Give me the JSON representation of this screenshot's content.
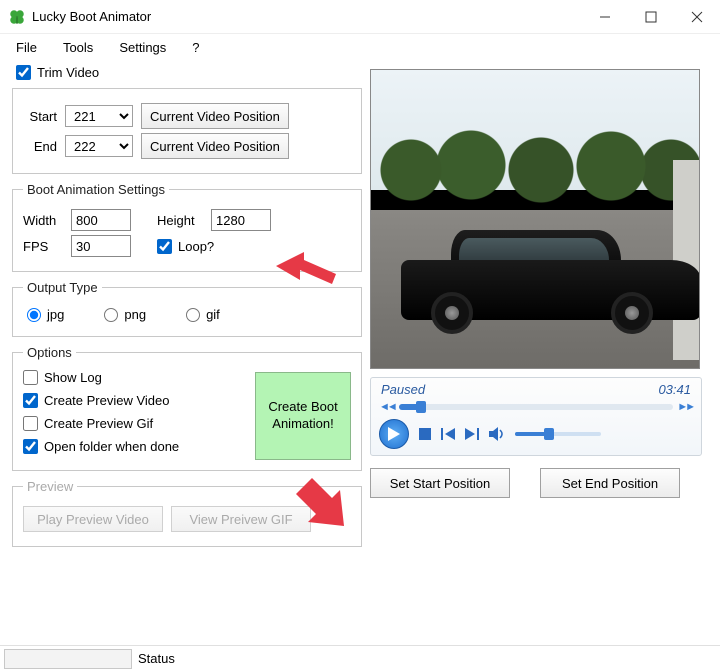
{
  "window": {
    "title": "Lucky Boot Animator"
  },
  "menu": {
    "file": "File",
    "tools": "Tools",
    "settings": "Settings",
    "help": "?"
  },
  "trim": {
    "label": "Trim Video",
    "start_lbl": "Start",
    "start_val": "221",
    "start_btn": "Current Video Position",
    "end_lbl": "End",
    "end_val": "222",
    "end_btn": "Current Video Position"
  },
  "bas": {
    "legend": "Boot Animation Settings",
    "width_lbl": "Width",
    "width_val": "800",
    "height_lbl": "Height",
    "height_val": "1280",
    "fps_lbl": "FPS",
    "fps_val": "30",
    "loop_lbl": "Loop?"
  },
  "output": {
    "legend": "Output Type",
    "jpg": "jpg",
    "png": "png",
    "gif": "gif"
  },
  "options": {
    "legend": "Options",
    "show_log": "Show Log",
    "preview_video": "Create Preview Video",
    "preview_gif": "Create Preview Gif",
    "open_folder": "Open folder when done",
    "create_btn": "Create Boot Animation!"
  },
  "preview": {
    "legend": "Preview",
    "play": "Play Preview Video",
    "view": "View Preivew GIF"
  },
  "player": {
    "status": "Paused",
    "time": "03:41"
  },
  "pos": {
    "start": "Set Start Position",
    "end": "Set End Position"
  },
  "status": {
    "label": "Status"
  }
}
